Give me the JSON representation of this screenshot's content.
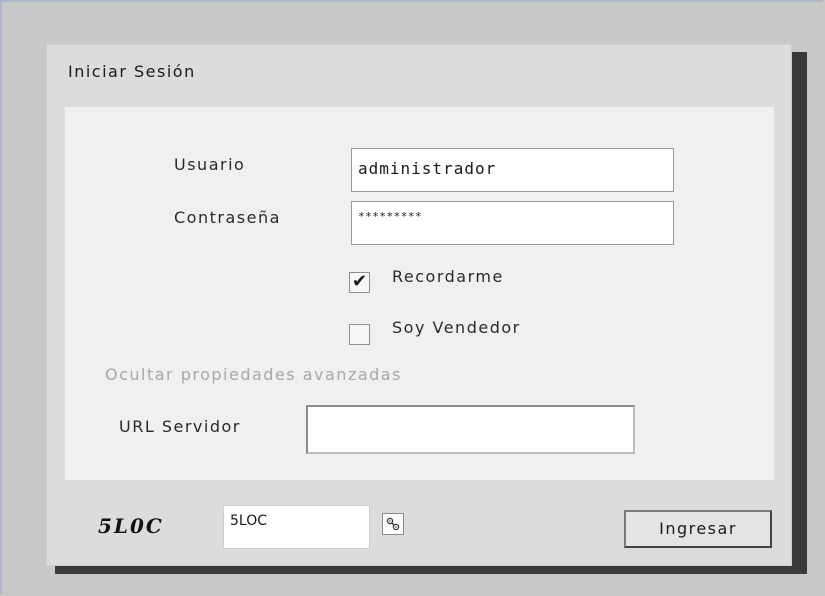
{
  "dialog": {
    "title": "Iniciar Sesión"
  },
  "form": {
    "username": {
      "label": "Usuario",
      "value": "administrador"
    },
    "password": {
      "label": "Contraseña",
      "value": "*********"
    },
    "remember": {
      "label": "Recordarme",
      "checked": true,
      "check_glyph": "✔"
    },
    "seller": {
      "label": "Soy Vendedor",
      "checked": false
    },
    "advanced_toggle": "Ocultar propiedades avanzadas",
    "server_url": {
      "label": "URL Servidor",
      "value": ""
    }
  },
  "footer": {
    "brand": "5L0C",
    "instance_value": "5LOC",
    "settings_icon": "link-gear-icon",
    "login_label": "Ingresar"
  },
  "colors": {
    "background": "#c8c8c8",
    "dialog": "#dcdcdc",
    "panel": "#f0f0f0",
    "shadow": "#3a3a3a",
    "muted_link": "#a8a8a8"
  }
}
